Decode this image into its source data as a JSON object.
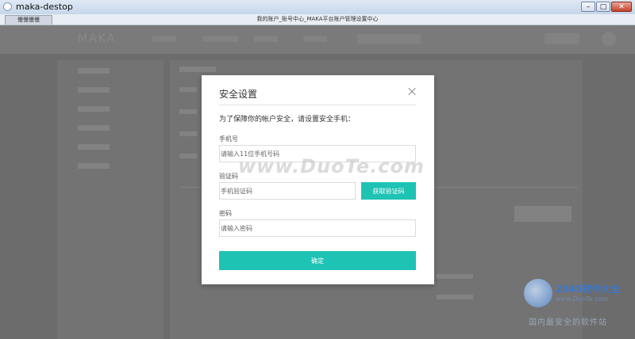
{
  "window": {
    "title": "maka-destop",
    "tab_label": "慢慢慢慢",
    "tab_title": "我的账户_账号中心_MAKA平台账户管理设置中心",
    "minimize_icon": "minimize-icon",
    "maximize_icon": "maximize-icon",
    "close_icon": "close-icon"
  },
  "background_page": {
    "logo": "MAKA"
  },
  "modal": {
    "title": "安全设置",
    "close_icon": "close-icon",
    "description": "为了保障你的帐户安全，请设置安全手机：",
    "phone": {
      "label": "手机号",
      "placeholder": "请输入11位手机号码",
      "value": ""
    },
    "code": {
      "label": "验证码",
      "placeholder": "手机验证码",
      "value": "",
      "button_label": "获取验证码"
    },
    "password": {
      "label": "密码",
      "placeholder": "请输入密码",
      "value": ""
    },
    "confirm_label": "确定",
    "accent_color": "#1ec3b4"
  },
  "watermarks": {
    "main": "www.DuoTe.com",
    "brand": "2345软件大全",
    "url": "www.DuoTe.com",
    "slogan": "国内最安全的软件站"
  }
}
